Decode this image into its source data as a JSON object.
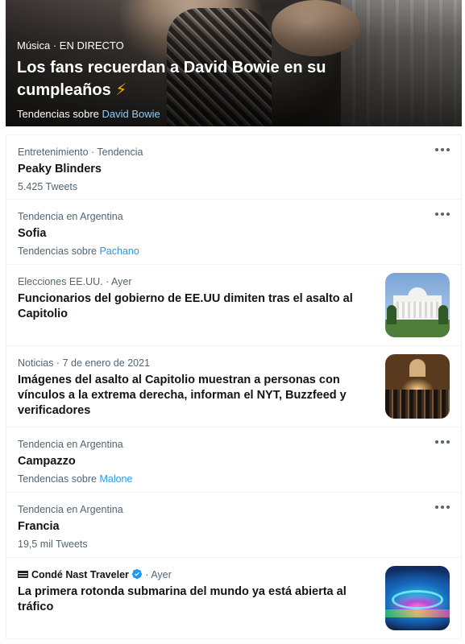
{
  "hero": {
    "category": "Música",
    "separator": "·",
    "status": "EN DIRECTO",
    "title": "Los fans recuerdan a David Bowie en su cumpleaños",
    "title_emoji": "⚡",
    "trend_prefix": "Tendencias sobre",
    "trend_link": "David Bowie"
  },
  "trends": [
    {
      "meta": "Entretenimiento · Tendencia",
      "title": "Peaky Blinders",
      "sub": "5.425 Tweets"
    },
    {
      "meta": "Tendencia en Argentina",
      "title": "Sofia",
      "sub_prefix": "Tendencias sobre",
      "sub_link": "Pachano"
    },
    {
      "meta": "Elecciones EE.UU. · Ayer",
      "title": "Funcionarios del gobierno de EE.UU dimiten tras el asalto al Capitolio",
      "thumb_icon": "white-house-photo"
    },
    {
      "meta": "Noticias · 7 de enero de 2021",
      "title": "Imágenes del asalto al Capitolio muestran a personas con vínculos a la extrema derecha, informan el NYT, Buzzfeed y verificadores",
      "thumb_icon": "capitol-riot-photo"
    },
    {
      "meta": "Tendencia en Argentina",
      "title": "Campazzo",
      "sub_prefix": "Tendencias sobre",
      "sub_link": "Malone"
    },
    {
      "meta": "Tendencia en Argentina",
      "title": "Francia",
      "sub": "19,5 mil Tweets"
    },
    {
      "publisher": "Condé Nast Traveler",
      "meta_suffix": "· Ayer",
      "title": "La primera rotonda submarina del mundo ya está abierta al tráfico",
      "thumb_icon": "underwater-roundabout-photo"
    }
  ],
  "icons": {
    "more": "more-options-icon",
    "verified": "verified-badge-icon"
  },
  "colors": {
    "accent": "#1d9bf0",
    "hero_link": "#8ecdf8",
    "text_primary": "#0f1419",
    "text_secondary": "#536471"
  }
}
